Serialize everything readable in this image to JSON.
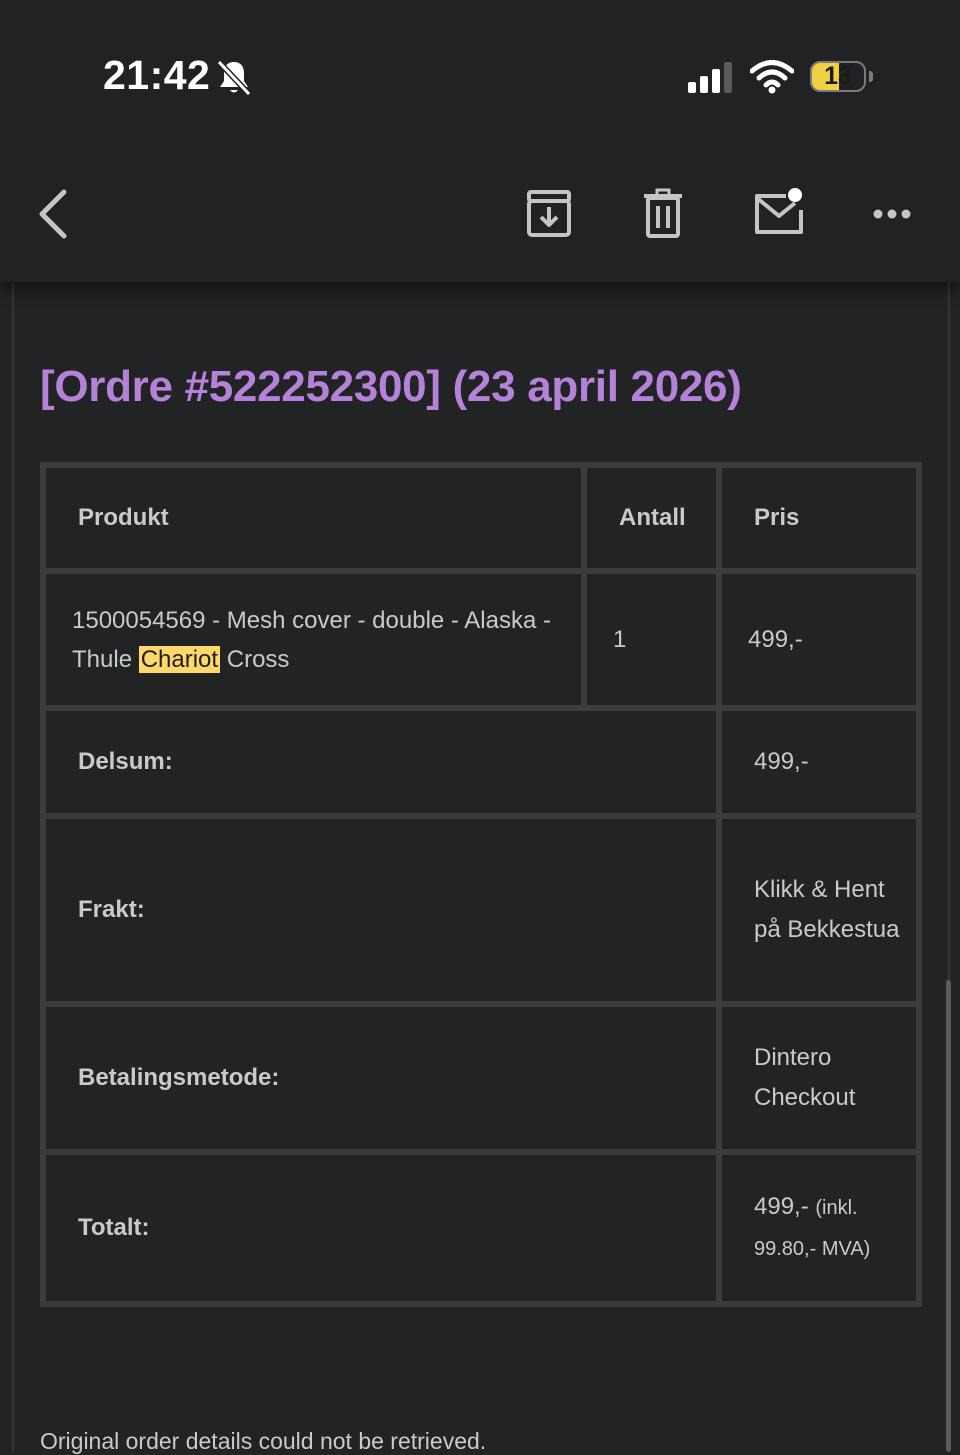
{
  "status_bar": {
    "time": "21:42",
    "battery_level": "13",
    "battery_color": "#f0d142",
    "icons": [
      "bell-slash-icon",
      "cellular-signal-icon",
      "wifi-icon",
      "battery-icon"
    ]
  },
  "toolbar": {
    "icons": [
      "back-chevron-icon",
      "archive-icon",
      "trash-icon",
      "mark-unread-icon",
      "more-icon"
    ]
  },
  "email": {
    "order_title": "[Ordre #522252300] (23 april 2026)",
    "title_color": "#b582d9",
    "table": {
      "headers": {
        "product": "Produkt",
        "quantity": "Antall",
        "price": "Pris"
      },
      "item": {
        "product_before": "1500054569 - Mesh cover - double - Alaska - Thule ",
        "product_highlight": "Chariot",
        "product_after": " Cross",
        "quantity": "1",
        "price": "499,-"
      },
      "subtotal": {
        "label": "Delsum:",
        "value": "499,-"
      },
      "shipping": {
        "label": "Frakt:",
        "value": "Klikk & Hent på Bekkestua"
      },
      "payment": {
        "label": "Betalingsmetode:",
        "value": "Dintero Checkout"
      },
      "total": {
        "label": "Totalt:",
        "value": "499,-",
        "note": "(inkl. 99.80,- MVA)"
      }
    },
    "footer_note": "Original order details could not be retrieved."
  }
}
